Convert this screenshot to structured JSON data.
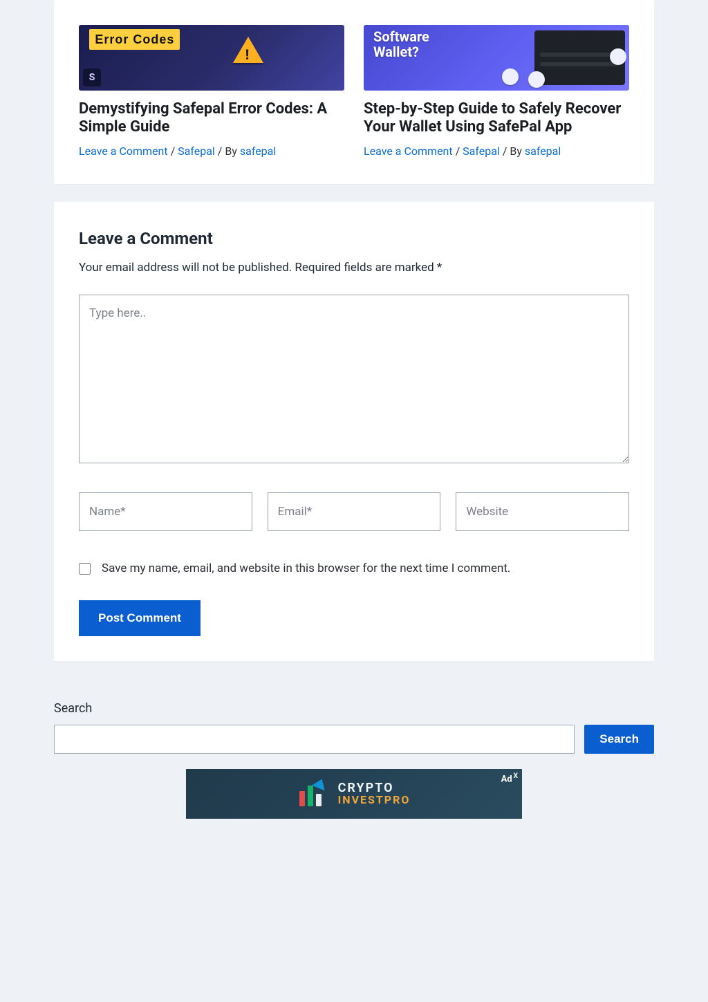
{
  "related": [
    {
      "thumb_stripe": "Error Codes",
      "title": "Demystifying Safepal Error Codes: A Simple Guide",
      "leave_comment": "Leave a Comment",
      "sep1": " / ",
      "category": "Safepal",
      "by": " / By ",
      "author": "safepal"
    },
    {
      "thumb_label": "Software\nWallet?",
      "title": "Step-by-Step Guide to Safely Recover Your Wallet Using SafePal App",
      "leave_comment": "Leave a Comment",
      "sep1": " / ",
      "category": "Safepal",
      "by": " / By ",
      "author": "safepal"
    }
  ],
  "comment_form": {
    "heading": "Leave a Comment",
    "note_prefix": "Your email address will not be published.",
    "note_required": " Required fields are marked ",
    "asterisk": "*",
    "placeholder_comment": "Type here..",
    "placeholder_name": "Name*",
    "placeholder_email": "Email*",
    "placeholder_website": "Website",
    "save_label": "Save my name, email, and website in this browser for the next time I comment.",
    "submit": "Post Comment"
  },
  "search": {
    "label": "Search",
    "button": "Search"
  },
  "ad": {
    "tag": "Ad",
    "tag_x": "X",
    "line1": "CRYPTO",
    "line2": "INVESTPRO"
  }
}
